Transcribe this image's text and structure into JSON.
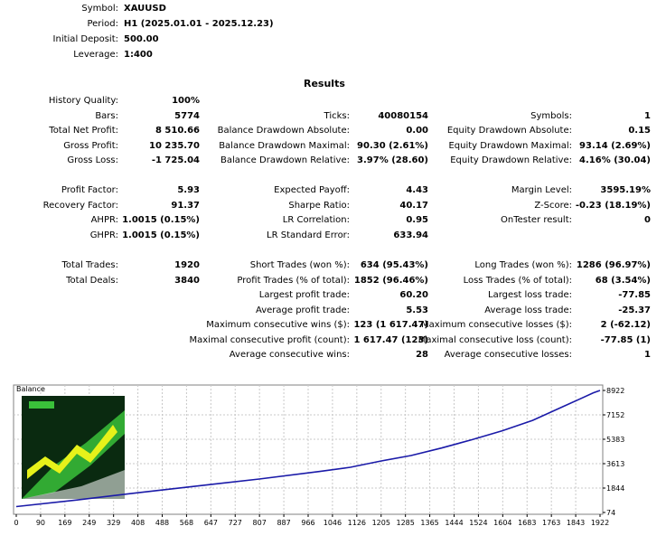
{
  "header": [
    {
      "label": "Symbol:",
      "value": "XAUUSD"
    },
    {
      "label": "Period:",
      "value": "H1 (2025.01.01 - 2025.12.23)"
    },
    {
      "label": "Initial Deposit:",
      "value": "500.00"
    },
    {
      "label": "Leverage:",
      "value": "1:400"
    }
  ],
  "results_title": "Results",
  "col1": [
    {
      "label": "History Quality:",
      "value": "100%"
    },
    {
      "label": "Bars:",
      "value": "5774"
    },
    {
      "label": "Total Net Profit:",
      "value": "8 510.66"
    },
    {
      "label": "Gross Profit:",
      "value": "10 235.70"
    },
    {
      "label": "Gross Loss:",
      "value": "-1 725.04"
    },
    {
      "label": "",
      "value": ""
    },
    {
      "label": "Profit Factor:",
      "value": "5.93"
    },
    {
      "label": "Recovery Factor:",
      "value": "91.37"
    },
    {
      "label": "AHPR:",
      "value": "1.0015 (0.15%)"
    },
    {
      "label": "GHPR:",
      "value": "1.0015 (0.15%)"
    },
    {
      "label": "",
      "value": ""
    },
    {
      "label": "Total Trades:",
      "value": "1920"
    },
    {
      "label": "Total Deals:",
      "value": "3840"
    }
  ],
  "col2": [
    {
      "label": "",
      "value": ""
    },
    {
      "label": "Ticks:",
      "value": "40080154"
    },
    {
      "label": "Balance Drawdown Absolute:",
      "value": "0.00"
    },
    {
      "label": "Balance Drawdown Maximal:",
      "value": "90.30 (2.61%)"
    },
    {
      "label": "Balance Drawdown Relative:",
      "value": "3.97% (28.60)"
    },
    {
      "label": "",
      "value": ""
    },
    {
      "label": "Expected Payoff:",
      "value": "4.43"
    },
    {
      "label": "Sharpe Ratio:",
      "value": "40.17"
    },
    {
      "label": "LR Correlation:",
      "value": "0.95"
    },
    {
      "label": "LR Standard Error:",
      "value": "633.94"
    },
    {
      "label": "",
      "value": ""
    },
    {
      "label": "Short Trades (won %):",
      "value": "634 (95.43%)"
    },
    {
      "label": "Profit Trades (% of total):",
      "value": "1852 (96.46%)"
    },
    {
      "label": "Largest profit trade:",
      "value": "60.20"
    },
    {
      "label": "Average profit trade:",
      "value": "5.53"
    },
    {
      "label": "Maximum consecutive wins ($):",
      "value": "123 (1 617.47)"
    },
    {
      "label": "Maximal consecutive profit (count):",
      "value": "1 617.47 (123)"
    },
    {
      "label": "Average consecutive wins:",
      "value": "28"
    }
  ],
  "col3": [
    {
      "label": "",
      "value": ""
    },
    {
      "label": "Symbols:",
      "value": "1"
    },
    {
      "label": "Equity Drawdown Absolute:",
      "value": "0.15"
    },
    {
      "label": "Equity Drawdown Maximal:",
      "value": "93.14 (2.69%)"
    },
    {
      "label": "Equity Drawdown Relative:",
      "value": "4.16% (30.04)"
    },
    {
      "label": "",
      "value": ""
    },
    {
      "label": "Margin Level:",
      "value": "3595.19%"
    },
    {
      "label": "Z-Score:",
      "value": "-0.23 (18.19%)"
    },
    {
      "label": "OnTester result:",
      "value": "0"
    },
    {
      "label": "",
      "value": ""
    },
    {
      "label": "",
      "value": ""
    },
    {
      "label": "Long Trades (won %):",
      "value": "1286 (96.97%)"
    },
    {
      "label": "Loss Trades (% of total):",
      "value": "68 (3.54%)"
    },
    {
      "label": "Largest loss trade:",
      "value": "-77.85"
    },
    {
      "label": "Average loss trade:",
      "value": "-25.37"
    },
    {
      "label": "Maximum consecutive losses ($):",
      "value": "2 (-62.12)"
    },
    {
      "label": "Maximal consecutive loss (count):",
      "value": "-77.85 (1)"
    },
    {
      "label": "Average consecutive losses:",
      "value": "1"
    }
  ],
  "chart_data": {
    "type": "line",
    "title": "Balance",
    "x_ticks": [
      "0",
      "90",
      "169",
      "249",
      "329",
      "408",
      "488",
      "568",
      "647",
      "727",
      "807",
      "887",
      "966",
      "1046",
      "1126",
      "1205",
      "1285",
      "1365",
      "1444",
      "1524",
      "1604",
      "1683",
      "1763",
      "1843",
      "1922"
    ],
    "y_ticks": [
      "8922",
      "7152",
      "5383",
      "3613",
      "1844",
      "74"
    ],
    "ylim": [
      74,
      8922
    ],
    "xlim": [
      0,
      1922
    ],
    "series": [
      {
        "color": "#1a1aa8",
        "x": [
          0,
          200,
          400,
          600,
          800,
          1000,
          1100,
          1200,
          1300,
          1400,
          1500,
          1600,
          1700,
          1800,
          1850,
          1900,
          1922
        ],
        "y": [
          500,
          980,
          1500,
          2000,
          2500,
          3050,
          3350,
          3800,
          4200,
          4750,
          5350,
          6000,
          6750,
          7750,
          8250,
          8750,
          8922
        ]
      }
    ]
  },
  "colors": {
    "line": "#1a1aa8",
    "grid": "#c8c8c8",
    "logo_bg": "#0a2a10",
    "logo_green": "#3ac13a",
    "logo_yellow": "#e7f21a"
  }
}
